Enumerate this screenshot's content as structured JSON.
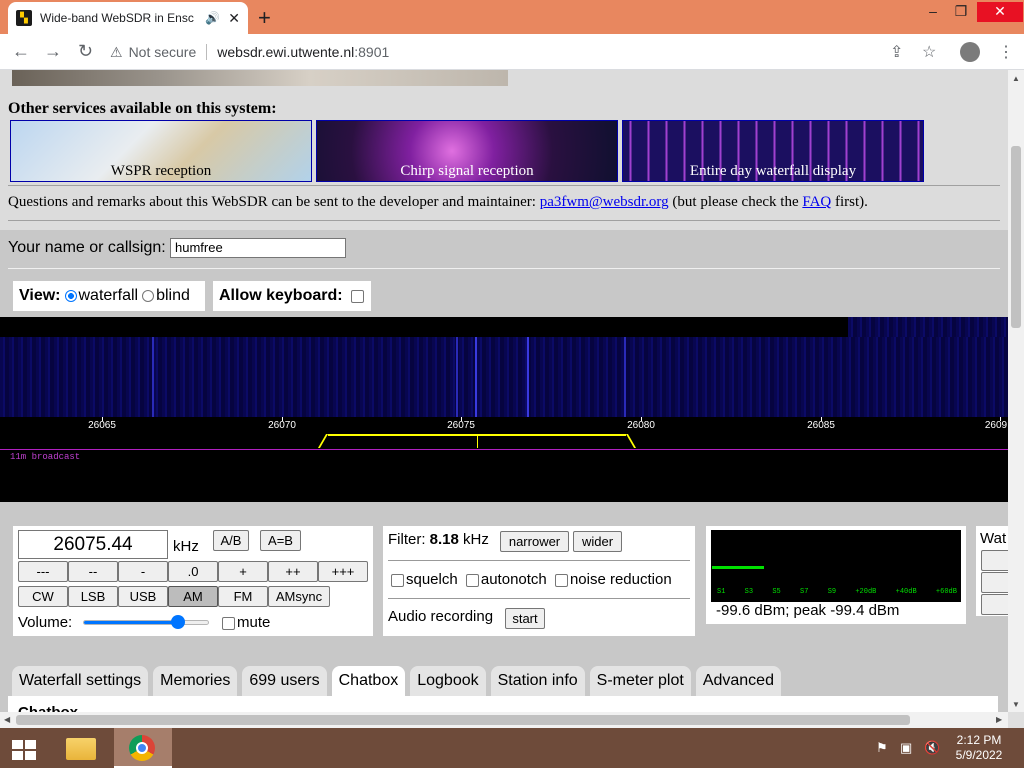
{
  "browser": {
    "tab_title": "Wide-band WebSDR in Ensc",
    "not_secure": "Not secure",
    "host": "websdr.ewi.utwente.nl",
    "port": ":8901",
    "new_tab": "+",
    "win_min": "–",
    "win_max": "❐",
    "win_close": "✕"
  },
  "services": {
    "title": "Other services available on this system:",
    "items": [
      {
        "label": "WSPR reception"
      },
      {
        "label": "Chirp signal reception"
      },
      {
        "label": "Entire day waterfall display"
      }
    ]
  },
  "questions": {
    "before": "Questions and remarks about this WebSDR can be sent to the developer and maintainer: ",
    "email": "pa3fwm@websdr.org",
    "middle": " (but please check the ",
    "faq": "FAQ",
    "after": " first)."
  },
  "callsign": {
    "label": "Your name or callsign:",
    "value": "humfree"
  },
  "view": {
    "label": "View:",
    "opt_waterfall": "waterfall",
    "opt_blind": "blind",
    "selected": "waterfall"
  },
  "keyboard": {
    "label": "Allow keyboard:",
    "checked": false
  },
  "scale": {
    "ticks": [
      "26065",
      "26070",
      "26075",
      "26080",
      "26085",
      "2609"
    ],
    "band_label": "11m broadcast"
  },
  "tuning": {
    "frequency": "26075.44",
    "unit": "kHz",
    "ab": "A/B",
    "aeqb": "A=B",
    "steps": [
      "---",
      "--",
      "-",
      ".0",
      "+",
      "++",
      "+++"
    ],
    "modes": [
      "CW",
      "LSB",
      "USB",
      "AM",
      "FM",
      "AMsync"
    ],
    "active_mode": "AM",
    "volume_label": "Volume:",
    "volume_level": 0.8,
    "mute_label": "mute"
  },
  "filter": {
    "label": "Filter:",
    "value": "8.18",
    "unit": "kHz",
    "narrower": "narrower",
    "wider": "wider",
    "squelch": "squelch",
    "autonotch": "autonotch",
    "noise_reduction": "noise reduction",
    "audio_recording": "Audio recording",
    "start": "start"
  },
  "smeter": {
    "labels": [
      "S1",
      "S3",
      "S5",
      "S7",
      "S9",
      "+20dB",
      "+40dB",
      "+60dB"
    ],
    "reading": "-99.6 dBm; peak  -99.4 dBm",
    "color": "#00e000"
  },
  "partial_panel": {
    "label": "Wat"
  },
  "tabs": [
    "Waterfall settings",
    "Memories",
    "699 users",
    "Chatbox",
    "Logbook",
    "Station info",
    "S-meter plot",
    "Advanced"
  ],
  "active_tab": "Chatbox",
  "panel": {
    "title": "Chatbox"
  },
  "taskbar": {
    "time": "2:12 PM",
    "date": "5/9/2022"
  }
}
